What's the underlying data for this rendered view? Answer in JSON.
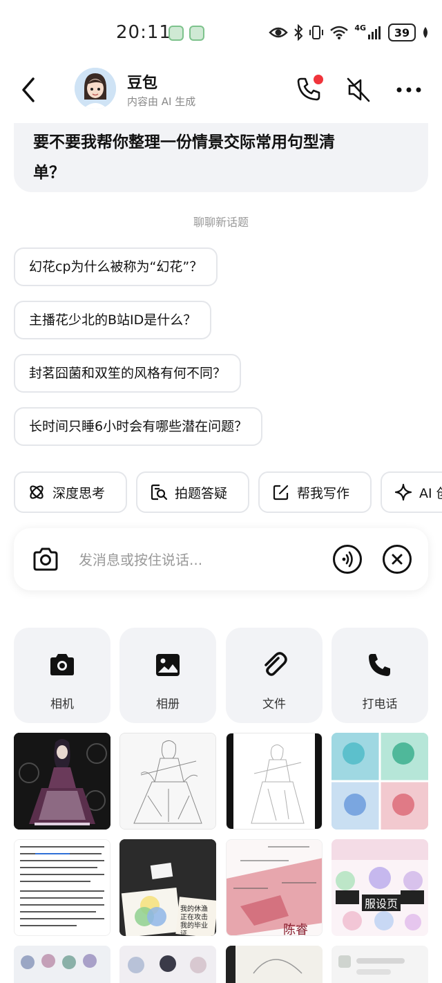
{
  "status_bar": {
    "time": "20:11",
    "network": "4G",
    "battery": "39"
  },
  "header": {
    "bot_name": "豆包",
    "bot_subtitle": "内容由 AI 生成"
  },
  "message": {
    "text_line1": "要不要我帮你整理一份情景交际常用句型清",
    "text_line2": "单？"
  },
  "new_topic_label": "聊聊新话题",
  "suggestions": [
    "幻花cp为什么被称为“幻花”？",
    "主播花少北的B站ID是什么？",
    "封茗囧菌和双笙的风格有何不同？",
    "长时间只睡6小时会有哪些潜在问题？"
  ],
  "tools": [
    {
      "label": "深度思考",
      "icon": "atom-icon"
    },
    {
      "label": "拍题答疑",
      "icon": "scan-question-icon"
    },
    {
      "label": "帮我写作",
      "icon": "edit-icon"
    },
    {
      "label": "AI 创作",
      "icon": "sparkle-icon"
    }
  ],
  "input": {
    "placeholder": "发消息或按住说话..."
  },
  "quick_actions": [
    {
      "label": "相机",
      "icon": "camera-icon"
    },
    {
      "label": "相册",
      "icon": "image-icon"
    },
    {
      "label": "文件",
      "icon": "paperclip-icon"
    },
    {
      "label": "打电话",
      "icon": "phone-icon"
    }
  ],
  "gallery_texts": {
    "thumb_8_title": "服设页",
    "thumb_7_name": "陈睿",
    "thumb_6_note_line1": "我的休渔",
    "thumb_6_note_line2": "正在攻击",
    "thumb_6_note_line3": "我的毕业证"
  },
  "colors": {
    "accent_red": "#f0343b",
    "chip_border": "#e4e6ea",
    "panel_bg": "#f2f3f6"
  }
}
